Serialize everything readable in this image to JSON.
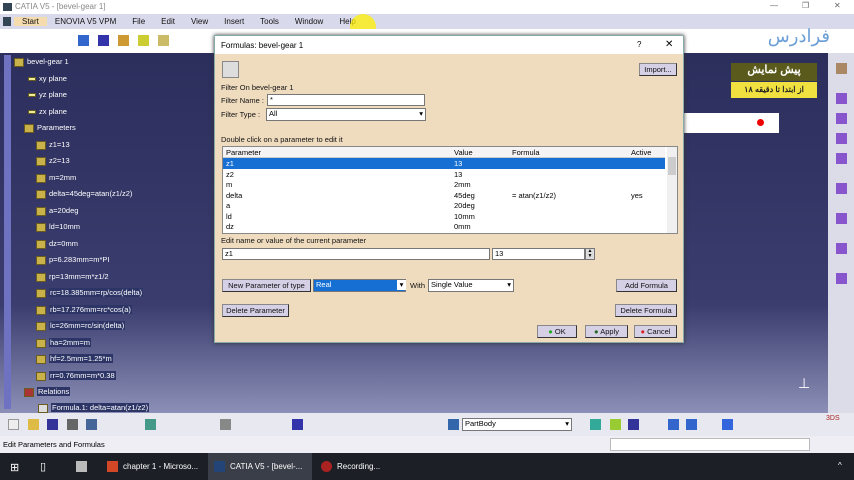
{
  "window": {
    "title": "CATIA V5 - [bevel-gear 1]"
  },
  "menu": [
    "Start",
    "ENOVIA V5 VPM",
    "File",
    "Edit",
    "View",
    "Insert",
    "Tools",
    "Window",
    "Help"
  ],
  "tree": {
    "root": "bevel-gear 1",
    "planes": [
      "xy plane",
      "yz plane",
      "zx plane"
    ],
    "parameters_label": "Parameters",
    "parameters": [
      "z1=13",
      "z2=13",
      "m=2mm",
      "delta=45deg=atan(z1/z2)",
      "a=20deg",
      "ld=10mm",
      "dz=0mm",
      "p=6.283mm=m*PI",
      "rp=13mm=m*z1/2",
      "rc=18.385mm=rp/cos(delta)",
      "rb=17.276mm=rc*cos(a)",
      "lc=26mm=rc/sin(delta)",
      "ha=2mm=m",
      "hf=2.5mm=1.25*m",
      "rr=0.76mm=m*0.38"
    ],
    "relations_label": "Relations",
    "relations": [
      "Formula.1: delta=atan(z1/z2)"
    ]
  },
  "watermark": {
    "logo": "فرادرس",
    "banner_title": "پیش نمایش",
    "banner_sub": "از ابتدا تا دقیقه ۱۸"
  },
  "dialog": {
    "title": "Formulas: bevel-gear 1",
    "help": "?",
    "close": "✕",
    "import": "Import...",
    "filter_on": "Filter On bevel-gear 1",
    "filter_name_label": "Filter Name :",
    "filter_name": "*",
    "filter_type_label": "Filter Type :",
    "filter_type": "All",
    "table_hint": "Double click on a parameter to edit it",
    "columns": [
      "Parameter",
      "Value",
      "Formula",
      "Active"
    ],
    "rows": [
      [
        "z1",
        "13",
        "",
        ""
      ],
      [
        "z2",
        "13",
        "",
        ""
      ],
      [
        "m",
        "2mm",
        "",
        ""
      ],
      [
        "delta",
        "45deg",
        "= atan(z1/z2)",
        "yes"
      ],
      [
        "a",
        "20deg",
        "",
        ""
      ],
      [
        "ld",
        "10mm",
        "",
        ""
      ],
      [
        "dz",
        "0mm",
        "",
        ""
      ]
    ],
    "edit_hint": "Edit name or value of the current parameter",
    "edit_name": "z1",
    "edit_value": "13",
    "new_param": "New Parameter of type",
    "param_type": "Real",
    "with": "With",
    "value_kind": "Single Value",
    "add_formula": "Add Formula",
    "delete_parameter": "Delete Parameter",
    "delete_formula": "Delete Formula",
    "ok": "OK",
    "apply": "Apply",
    "cancel": "Cancel"
  },
  "toolbar": {
    "body_select": "PartBody"
  },
  "status": "Edit Parameters and Formulas",
  "taskbar": [
    "chapter 1 - Microso...",
    "CATIA V5 - [bevel-...",
    "Recording..."
  ]
}
